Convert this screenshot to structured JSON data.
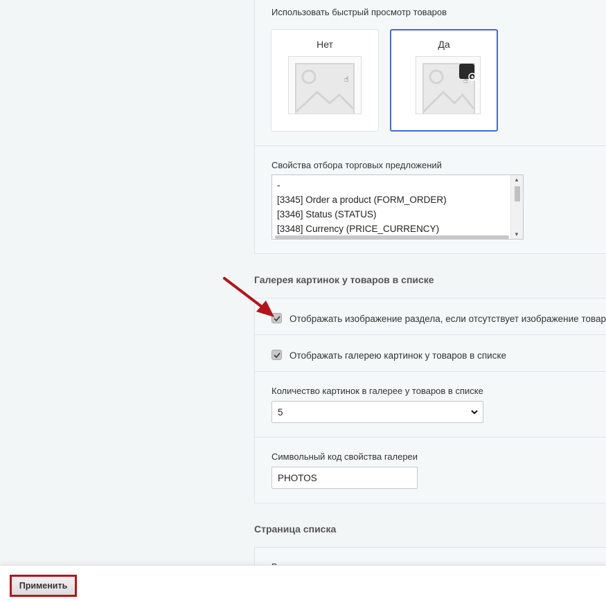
{
  "quick_view": {
    "label": "Использовать быстрый просмотр товаров",
    "options": [
      {
        "label": "Нет",
        "selected": false
      },
      {
        "label": "Да",
        "selected": true
      }
    ]
  },
  "offer_props": {
    "label": "Свойства отбора торговых предложений",
    "items": [
      "-",
      "[3345] Order a product (FORM_ORDER)",
      "[3346] Status (STATUS)",
      "[3348] Currency (PRICE_CURRENCY)"
    ]
  },
  "gallery_section": {
    "title": "Галерея картинок у товаров в списке",
    "show_section_image": {
      "label": "Отображать изображение раздела, если отсутствует изображение товара",
      "checked": true
    },
    "show_gallery": {
      "label": "Отображать галерею картинок у товаров в списке",
      "checked": true
    },
    "count": {
      "label": "Количество картинок в галерее у товаров в списке",
      "value": "5"
    },
    "prop_code": {
      "label": "Символьный код свойства галереи",
      "value": "PHOTOS"
    }
  },
  "list_page": {
    "title": "Страница списка",
    "partial_label": "В"
  },
  "footer": {
    "apply_label": "Применить"
  },
  "colors": {
    "accent": "#3d6bd1",
    "annotation": "#b3151a"
  }
}
